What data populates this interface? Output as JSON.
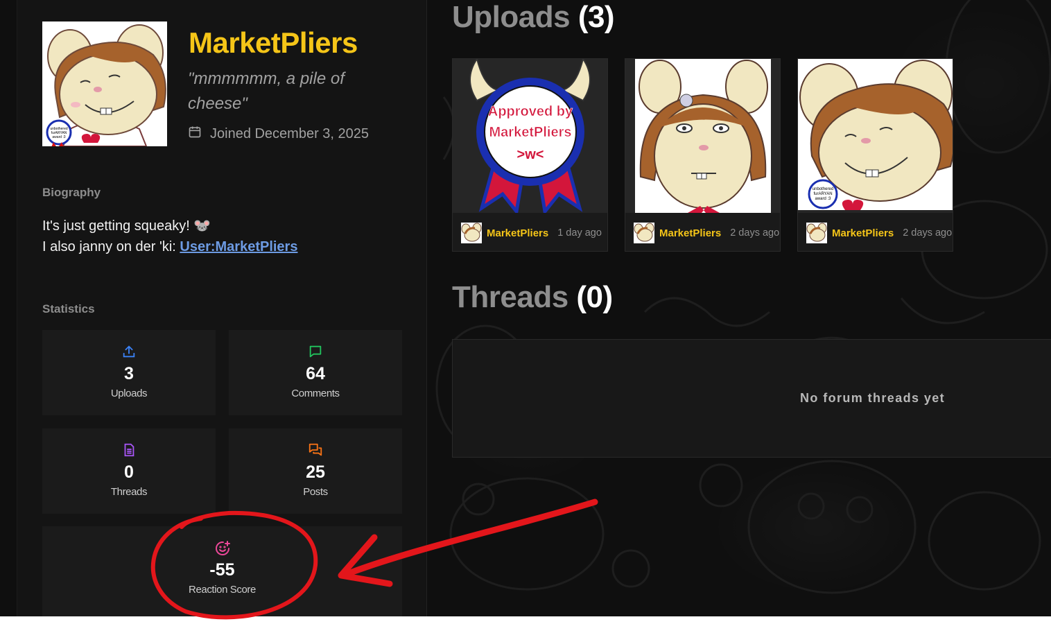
{
  "profile": {
    "username": "MarketPliers",
    "tagline": "\"mmmmmm, a pile of cheese\"",
    "joined": "Joined December 3, 2025"
  },
  "biography": {
    "heading": "Biography",
    "line1": "It's just getting squeaky! 🐭",
    "line2_prefix": "I also janny on der 'ki: ",
    "link_text": "User:MarketPliers"
  },
  "statistics": {
    "heading": "Statistics",
    "items": [
      {
        "value": "3",
        "label": "Uploads",
        "icon": "upload-icon",
        "color": "#3b82f6"
      },
      {
        "value": "64",
        "label": "Comments",
        "icon": "comment-icon",
        "color": "#22c55e"
      },
      {
        "value": "0",
        "label": "Threads",
        "icon": "document-icon",
        "color": "#a855f7"
      },
      {
        "value": "25",
        "label": "Posts",
        "icon": "messages-icon",
        "color": "#f97316"
      },
      {
        "value": "-55",
        "label": "Reaction Score",
        "icon": "smile-plus-icon",
        "color": "#ec4899"
      }
    ]
  },
  "uploads": {
    "title": "Uploads",
    "count": "(3)",
    "items": [
      {
        "author": "MarketPliers",
        "time": "1 day ago",
        "ribbon_line1": "Approved by",
        "ribbon_line2": "MarketPliers",
        "ribbon_line3": ">w<"
      },
      {
        "author": "MarketPliers",
        "time": "2 days ago"
      },
      {
        "author": "MarketPliers",
        "time": "2 days ago"
      }
    ]
  },
  "threads": {
    "title": "Threads",
    "count": "(0)",
    "empty": "No forum threads yet"
  },
  "badge": {
    "line1": "unbothered",
    "line2": "furARYAN",
    "line3": "award :3"
  },
  "colors": {
    "accent": "#f5c518",
    "annotation": "#e3161b",
    "link": "#6d9be3"
  }
}
